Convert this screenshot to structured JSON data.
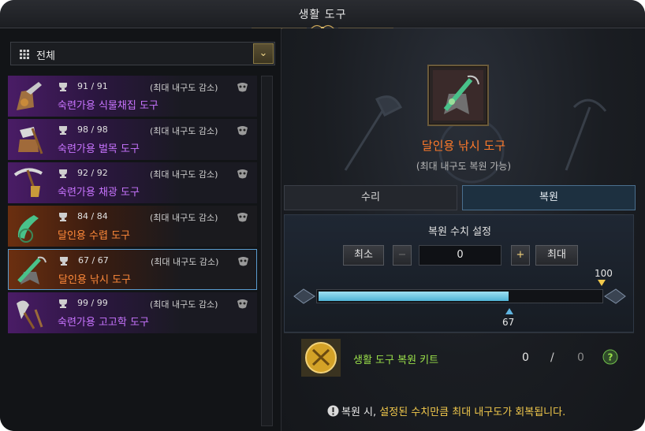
{
  "window": {
    "title": "생활 도구"
  },
  "filter": {
    "selected": "전체"
  },
  "tools": [
    {
      "durability": "91 / 91",
      "note": "(최대 내구도 감소)",
      "name": "숙련가용 식물채집 도구",
      "grade": "purple",
      "icon": "herb-gathering-tool-icon"
    },
    {
      "durability": "98 / 98",
      "note": "(최대 내구도 감소)",
      "name": "숙련가용 벌목 도구",
      "grade": "purple",
      "icon": "logging-tool-icon"
    },
    {
      "durability": "92 / 92",
      "note": "(최대 내구도 감소)",
      "name": "숙련가용 채광 도구",
      "grade": "purple",
      "icon": "mining-tool-icon"
    },
    {
      "durability": "84 / 84",
      "note": "(최대 내구도 감소)",
      "name": "달인용 수렵 도구",
      "grade": "orange",
      "icon": "hunting-tool-icon"
    },
    {
      "durability": "67 / 67",
      "note": "(최대 내구도 감소)",
      "name": "달인용 낚시 도구",
      "grade": "orange",
      "icon": "fishing-tool-icon",
      "selected": true
    },
    {
      "durability": "99 / 99",
      "note": "(최대 내구도 감소)",
      "name": "숙련가용 고고학 도구",
      "grade": "purple",
      "icon": "archaeology-tool-icon"
    }
  ],
  "detail": {
    "tool_name": "달인용 낚시 도구",
    "tool_subtitle": "(최대 내구도 복원 가능)",
    "tabs": {
      "repair": "수리",
      "restore": "복원"
    },
    "setting": {
      "title": "복원 수치 설정",
      "min_label": "최소",
      "max_label": "최대",
      "minus": "−",
      "plus": "+",
      "value": "0",
      "slider_max": "100",
      "slider_current": "67",
      "slider_fraction": 0.67
    },
    "kit": {
      "name": "생활 도구 복원 키트",
      "have": "0",
      "sep": "/",
      "need": "0"
    },
    "notice": {
      "prefix": "복원 시, ",
      "highlight": "설정된 수치만큼 최대 내구도가 회복됩니다."
    }
  },
  "colors": {
    "purple_grade": "#c874ff",
    "orange_grade": "#ff8a3a",
    "kit_green": "#9be14a",
    "accent_blue": "#4fb3d6"
  }
}
